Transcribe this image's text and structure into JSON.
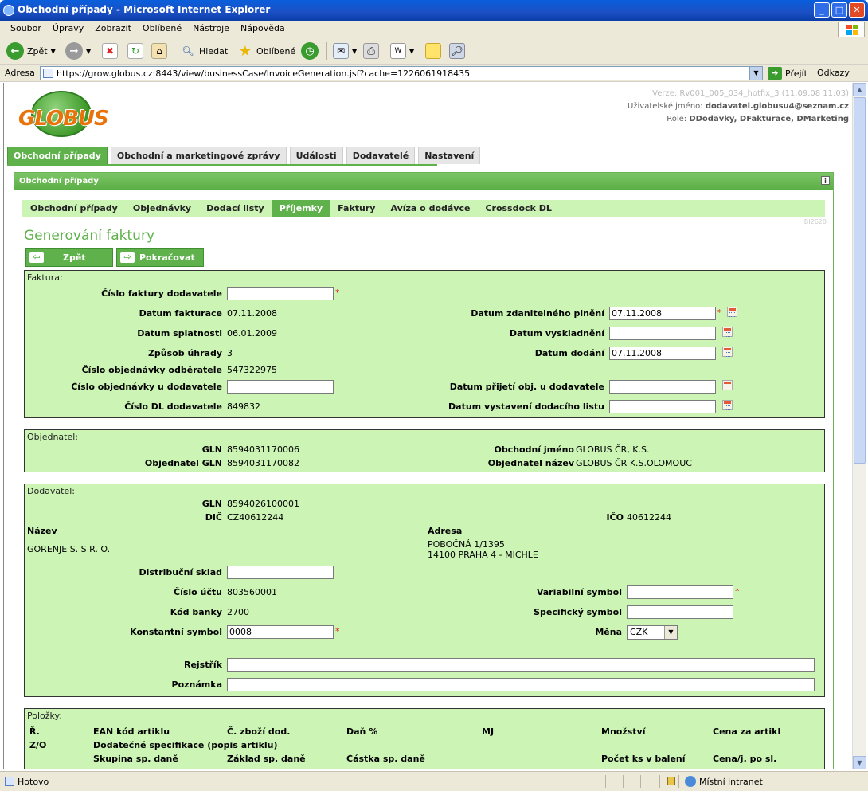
{
  "window": {
    "title": "Obchodní případy - Microsoft Internet Explorer"
  },
  "menu": [
    "Soubor",
    "Úpravy",
    "Zobrazit",
    "Oblíbené",
    "Nástroje",
    "Nápověda"
  ],
  "toolbar": {
    "back": "Zpět",
    "search": "Hledat",
    "favorites": "Oblíbené"
  },
  "address": {
    "label": "Adresa",
    "url": "https://grow.globus.cz:8443/view/businessCase/InvoiceGeneration.jsf?cache=1226061918435",
    "go": "Přejít",
    "links": "Odkazy"
  },
  "status": {
    "text": "Hotovo",
    "zone": "Místní intranet"
  },
  "app": {
    "logo": "GLOBUS",
    "version": "Verze: Rv001_005_034_hotfix_3 (11.09.08 11:03)",
    "user_label": "Uživatelské jméno:",
    "user": "dodavatel.globusu4@seznam.cz",
    "role_label": "Role:",
    "roles": "DDodavky, DFakturace, DMarketing",
    "main_tabs": [
      "Obchodní případy",
      "Obchodní a marketingové zprávy",
      "Události",
      "Dodavatelé",
      "Nastavení"
    ],
    "panel_title": "Obchodní případy",
    "sub_tabs": [
      "Obchodní případy",
      "Objednávky",
      "Dodací listy",
      "Příjemky",
      "Faktury",
      "Avíza o dodávce",
      "Crossdock DL"
    ],
    "bi_code": "BI2620",
    "page_title": "Generování faktury",
    "btn_back": "Zpět",
    "btn_continue": "Pokračovat"
  },
  "faktura": {
    "title": "Faktura:",
    "cislo_faktury_label": "Číslo faktury dodavatele",
    "cislo_faktury": "",
    "datum_fakturace_label": "Datum fakturace",
    "datum_fakturace": "07.11.2008",
    "datum_splatnosti_label": "Datum splatnosti",
    "datum_splatnosti": "06.01.2009",
    "zpusob_uhrady_label": "Způsob úhrady",
    "zpusob_uhrady": "3",
    "cislo_obj_odb_label": "Číslo objednávky odběratele",
    "cislo_obj_odb": "547322975",
    "cislo_obj_dod_label": "Číslo objednávky u dodavatele",
    "cislo_obj_dod": "",
    "cislo_dl_label": "Číslo DL dodavatele",
    "cislo_dl": "849832",
    "datum_zdan_label": "Datum zdanitelného plnění",
    "datum_zdan": "07.11.2008",
    "datum_vysklad_label": "Datum vyskladnění",
    "datum_vysklad": "",
    "datum_dodani_label": "Datum dodání",
    "datum_dodani": "07.11.2008",
    "datum_prijeti_label": "Datum přijetí obj. u dodavatele",
    "datum_prijeti": "",
    "datum_vystaveni_label": "Datum vystavení dodacího listu",
    "datum_vystaveni": ""
  },
  "objednatel": {
    "title": "Objednatel:",
    "gln_label": "GLN",
    "gln": "8594031170006",
    "obj_gln_label": "Objednatel GLN",
    "obj_gln": "8594031170082",
    "obch_jmeno_label": "Obchodní jméno",
    "obch_jmeno": "GLOBUS ČR, K.S.",
    "obj_nazev_label": "Objednatel název",
    "obj_nazev": "GLOBUS ČR K.S.OLOMOUC"
  },
  "dodavatel": {
    "title": "Dodavatel:",
    "gln_label": "GLN",
    "gln": "8594026100001",
    "dic_label": "DIČ",
    "dic": "CZ40612244",
    "ico_label": "IČO",
    "ico": "40612244",
    "nazev_label": "Název",
    "nazev": "GORENJE S. S R. O.",
    "adresa_label": "Adresa",
    "adresa1": "POBOČNÁ 1/1395",
    "adresa2": "14100 PRAHA 4 - MICHLE",
    "sklad_label": "Distribuční sklad",
    "sklad": "",
    "ucet_label": "Číslo účtu",
    "ucet": "803560001",
    "banka_label": "Kód banky",
    "banka": "2700",
    "konst_label": "Konstantní symbol",
    "konst": "0008",
    "var_label": "Variabilní symbol",
    "var": "",
    "spec_label": "Specifický symbol",
    "spec": "",
    "mena_label": "Měna",
    "mena": "CZK",
    "rejstrik_label": "Rejstřík",
    "rejstrik": "",
    "poznamka_label": "Poznámka",
    "poznamka": ""
  },
  "polozky": {
    "title": "Položky:",
    "row1": [
      "Ř.",
      "EAN kód artiklu",
      "Č. zboží dod.",
      "Daň %",
      "MJ",
      "Množství",
      "Cena za artikl"
    ],
    "row2": [
      "Z/O",
      "Dodatečné specifikace (popis artiklu)"
    ],
    "row3": [
      "Skupina sp. daně",
      "Základ sp. daně",
      "Částka sp. daně",
      "Počet ks v balení",
      "Cena/j. po sl."
    ]
  }
}
